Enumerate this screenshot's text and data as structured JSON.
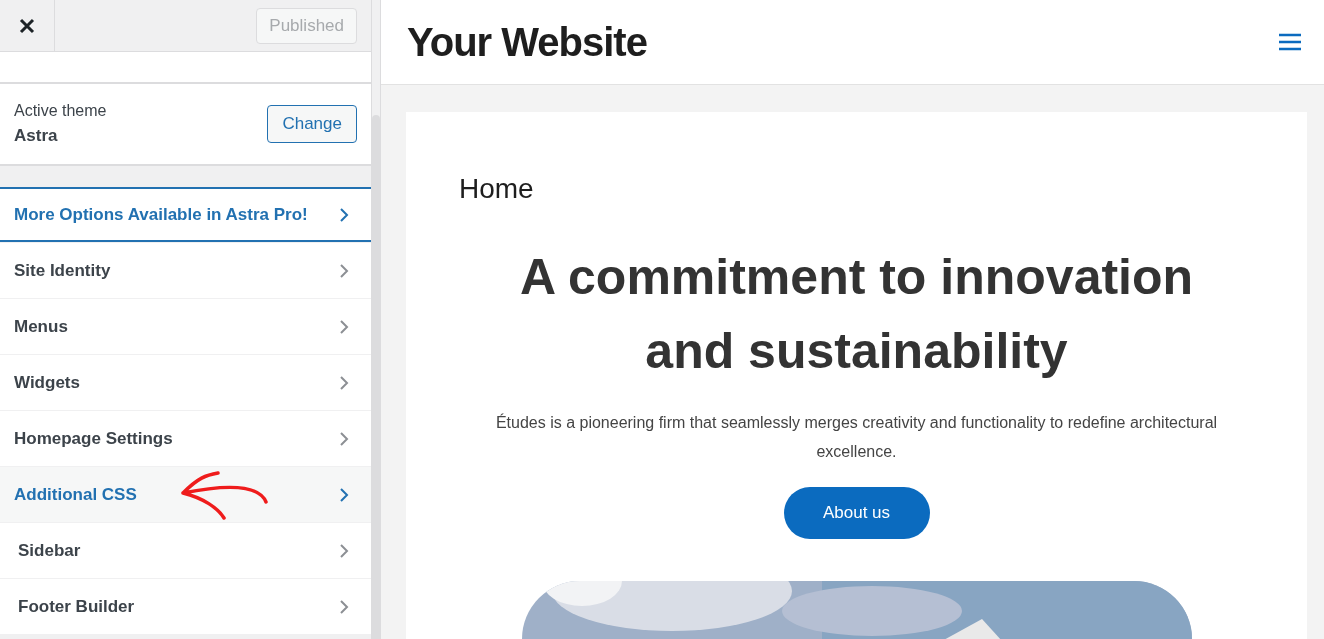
{
  "header": {
    "publish_button": "Published"
  },
  "sidebar": {
    "active_theme": {
      "label": "Active theme",
      "name": "Astra",
      "button": "Change"
    },
    "items": [
      {
        "label": "More Options Available in Astra Pro!",
        "kind": "promo",
        "selected": false
      },
      {
        "label": "Site Identity",
        "kind": "section",
        "selected": false
      },
      {
        "label": "Menus",
        "kind": "section",
        "selected": false
      },
      {
        "label": "Widgets",
        "kind": "section",
        "selected": false
      },
      {
        "label": "Homepage Settings",
        "kind": "section",
        "selected": false
      },
      {
        "label": "Additional CSS",
        "kind": "section",
        "selected": true
      },
      {
        "label": "Sidebar",
        "kind": "builder",
        "selected": false
      },
      {
        "label": "Footer Builder",
        "kind": "builder",
        "selected": false
      }
    ]
  },
  "preview": {
    "site_title": "Your Website",
    "page_title": "Home",
    "heading": "A commitment to innovation and sustainability",
    "text": "Études is a pioneering firm that seamlessly merges creativity and functionality to redefine architectural excellence.",
    "button": "About us"
  }
}
